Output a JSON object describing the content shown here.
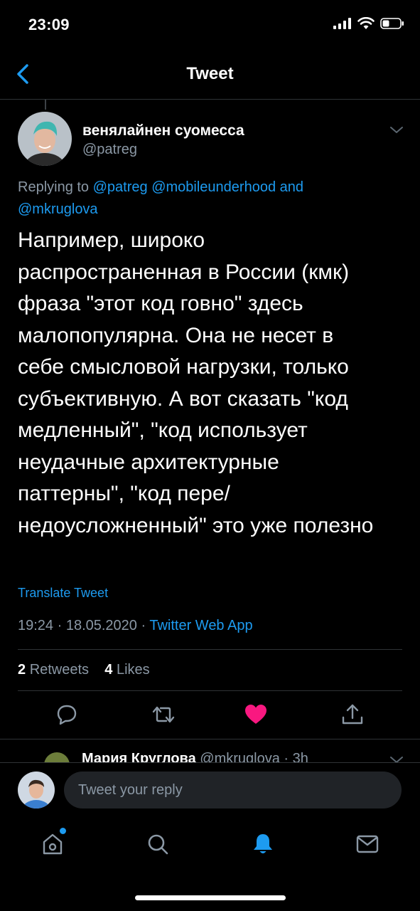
{
  "status_bar": {
    "time": "23:09"
  },
  "header": {
    "title": "Tweet"
  },
  "tweet": {
    "display_name": "венялайнен суомесса",
    "handle": "@patreg",
    "replying_prefix": "Replying to",
    "replying_handles": [
      "@patreg",
      "@mobileunderhood"
    ],
    "replying_and": "and",
    "replying_last": "@mkruglova",
    "text": "Например, широко\nраспространенная в России (кмк)\nфраза \"этот код говно\" здесь\nмалопопулярна. Она не несет в\nсебе смысловой нагрузки, только\nсубъективную. А вот сказать \"код\nмедленный\", \"код использует\nнеудачные архитектурные\nпаттерны\", \"код пере/\nнедоусложненный\" это уже полезно",
    "translate_label": "Translate Tweet",
    "timestamp": "19:24 · 18.05.2020 ·",
    "source": "Twitter Web App",
    "retweets_count": "2",
    "retweets_label": "Retweets",
    "likes_count": "4",
    "likes_label": "Likes"
  },
  "next_tweet": {
    "display_name": "Мария Круглова",
    "handle_time": "@mkruglova · 3h"
  },
  "reply": {
    "placeholder": "Tweet your reply"
  },
  "colors": {
    "accent": "#1d9bf0",
    "like": "#f91880",
    "muted": "#8b98a5",
    "divider": "#2f3336"
  },
  "icons": [
    "back-chevron-icon",
    "chevron-down-icon",
    "reply-icon",
    "retweet-icon",
    "heart-icon",
    "share-icon",
    "home-icon",
    "search-icon",
    "notifications-icon",
    "messages-icon"
  ]
}
